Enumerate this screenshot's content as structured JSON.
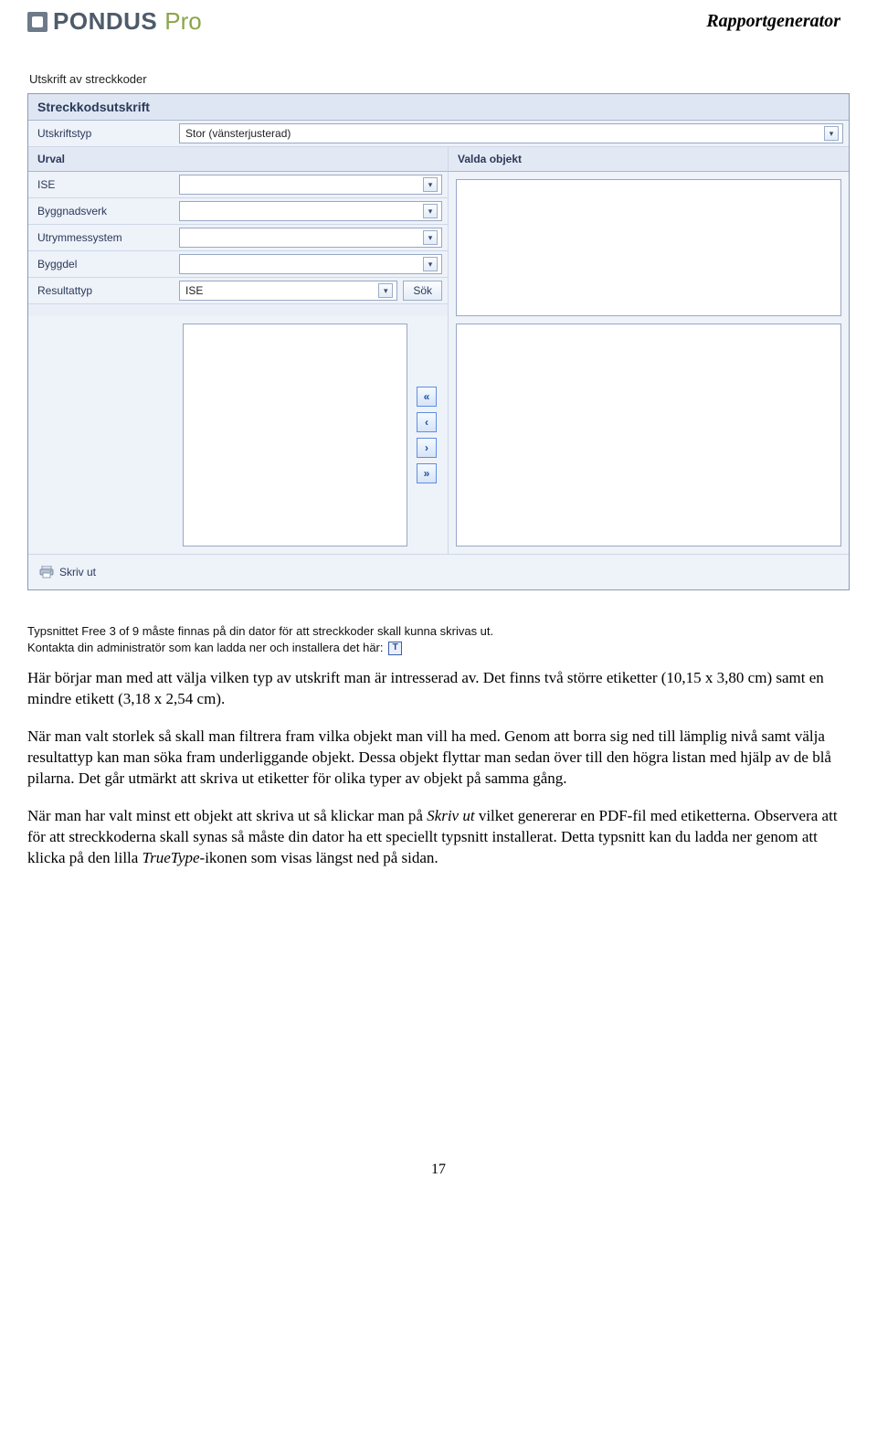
{
  "header": {
    "brand": "PONDUS",
    "brand_suffix": "Pro",
    "doc_title": "Rapportgenerator"
  },
  "page_label": "Utskrift av streckkoder",
  "panel": {
    "title": "Streckkodsutskrift",
    "print_type_label": "Utskriftstyp",
    "print_type_value": "Stor (vänsterjusterad)",
    "urval_heading": "Urval",
    "valda_heading": "Valda objekt",
    "filters": {
      "ise": "ISE",
      "byggnadsverk": "Byggnadsverk",
      "utrymmessystem": "Utrymmessystem",
      "byggdel": "Byggdel",
      "resultattyp_label": "Resultattyp",
      "resultattyp_value": "ISE",
      "search_btn": "Sök"
    },
    "print_btn": "Skriv ut"
  },
  "note": {
    "line1": "Typsnittet Free 3 of 9 måste finnas på din dator för att streckkoder skall kunna skrivas ut.",
    "line2": "Kontakta din administratör som kan ladda ner och installera det här:"
  },
  "body": {
    "p1": "Här börjar man med att välja vilken typ av utskrift man är intresserad av. Det finns två större etiketter (10,15 x 3,80 cm) samt en mindre etikett (3,18 x 2,54 cm).",
    "p2": "När man valt storlek så skall man filtrera fram vilka objekt man vill ha med. Genom att borra sig ned till lämplig nivå samt välja resultattyp kan man söka fram underliggande objekt. Dessa objekt flyttar man sedan över till den högra listan med hjälp av de blå pilarna. Det går utmärkt att skriva ut etiketter för olika typer av objekt på samma gång.",
    "p3a": "När man har valt minst ett objekt att skriva ut så klickar man på ",
    "p3_em1": "Skriv ut",
    "p3b": " vilket genererar en PDF-fil med etiketterna. Observera att för att streckkoderna skall synas så måste din dator ha ett speciellt typsnitt installerat. Detta typsnitt kan du ladda ner genom att klicka på den lilla ",
    "p3_em2": "TrueType",
    "p3c": "-ikonen som visas längst ned på sidan."
  },
  "page_number": "17"
}
